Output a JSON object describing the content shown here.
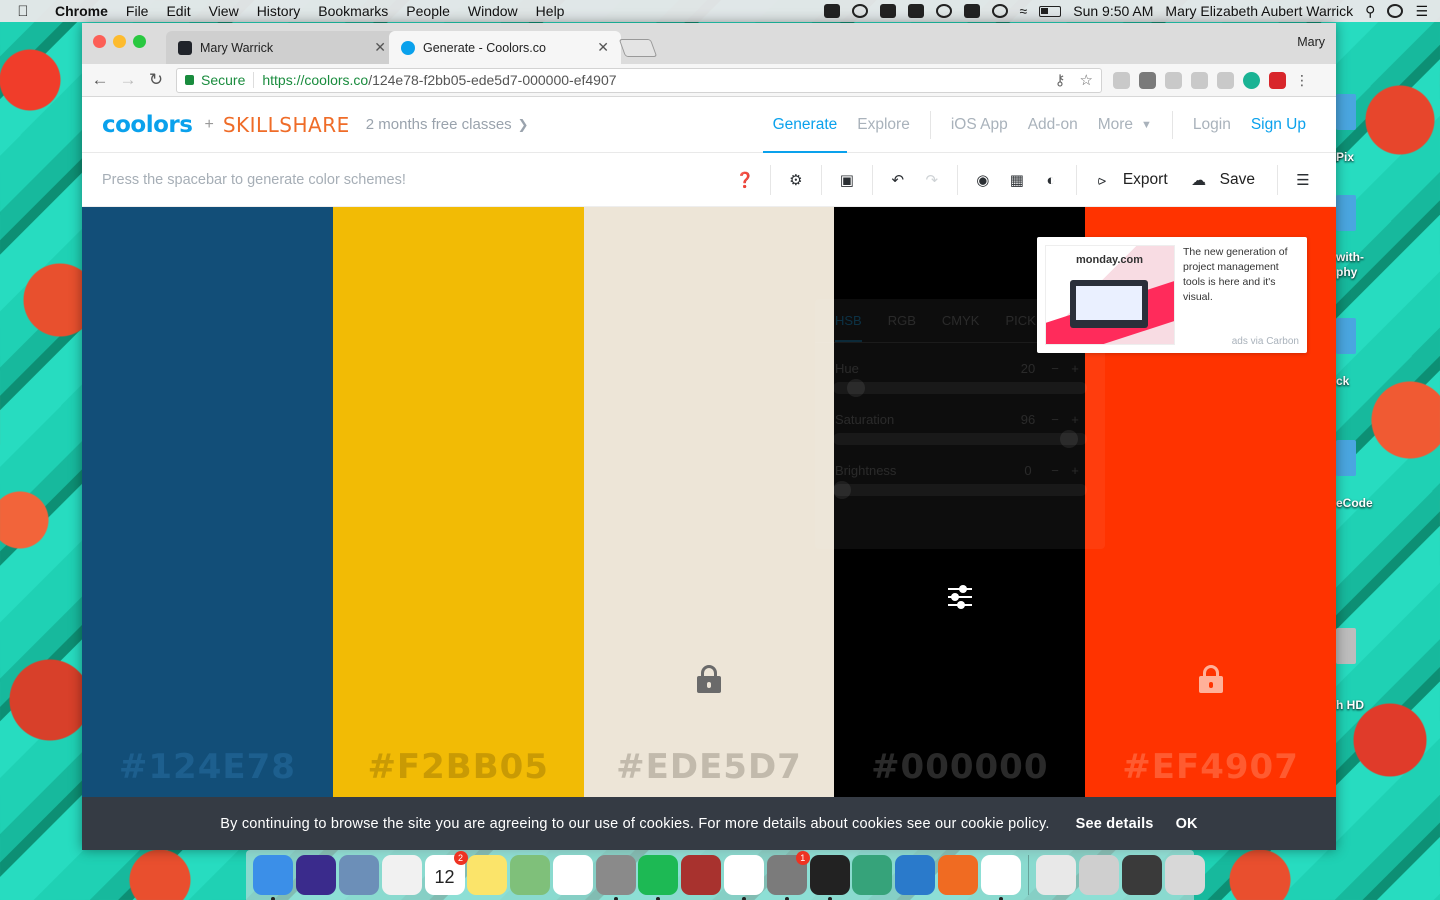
{
  "menubar": {
    "apple": "",
    "items": [
      "Chrome",
      "File",
      "Edit",
      "View",
      "History",
      "Bookmarks",
      "People",
      "Window",
      "Help"
    ],
    "clock": "Sun 9:50 AM",
    "user": "Mary Elizabeth Aubert Warrick"
  },
  "browser": {
    "tabs": [
      {
        "title": "Mary Warrick",
        "favicon_color": "#20232a"
      },
      {
        "title": "Generate - Coolors.co",
        "favicon_color": "#0aa1ec"
      }
    ],
    "profile": "Mary",
    "secure_label": "Secure",
    "url_scheme_host": "https://coolors.co",
    "url_path": "/124e78-f2bb05-ede5d7-000000-ef4907"
  },
  "site": {
    "logo": "coolors",
    "plus": "+",
    "partner": "SKILLSHARE",
    "promo": "2 months free classes",
    "nav": {
      "generate": "Generate",
      "explore": "Explore",
      "ios": "iOS App",
      "addon": "Add-on",
      "more": "More",
      "login": "Login",
      "signup": "Sign Up"
    },
    "hint": "Press the spacebar to generate color schemes!",
    "export_label": "Export",
    "save_label": "Save"
  },
  "palette": {
    "colors": [
      {
        "hex": "#124E78",
        "bg": "#124e78",
        "fg": "#1d5f8e",
        "locked": false
      },
      {
        "hex": "#F2BB05",
        "bg": "#f2bb05",
        "fg": "#c99a04",
        "locked": false
      },
      {
        "hex": "#EDE5D7",
        "bg": "#ede5d7",
        "fg": "#c2baac",
        "locked": true,
        "lock_color": "#6a6a6a"
      },
      {
        "hex": "#000000",
        "bg": "#000000",
        "fg": "#2a2a2a",
        "locked": false
      },
      {
        "hex": "#EF4907",
        "bg": "#ff3300",
        "fg": "#ff5b30",
        "locked": true,
        "lock_color": "#ffb199"
      }
    ]
  },
  "adjust": {
    "tabs": [
      "HSB",
      "RGB",
      "CMYK",
      "PICK"
    ],
    "hue_label": "Hue",
    "hue_value": "20",
    "saturation_label": "Saturation",
    "saturation_value": "96",
    "brightness_label": "Brightness",
    "brightness_value": "0",
    "hue_level": 0.06,
    "saturation_level": 0.96,
    "brightness_level": 0.0
  },
  "ad": {
    "brand": "monday.com",
    "text": "The new generation of project management tools is here and it's visual.",
    "via": "ads via Carbon"
  },
  "cookie": {
    "message": "By continuing to browse the site you are agreeing to our use of cookies. For more details about cookies see our cookie policy.",
    "details": "See details",
    "ok": "OK"
  },
  "desktop": {
    "labels": [
      "Pix",
      "with-\nphy",
      "ck",
      "eCode",
      "h HD"
    ]
  },
  "dock": {
    "apps": [
      {
        "name": "finder",
        "color": "#3b8fe8",
        "dot": true
      },
      {
        "name": "siri",
        "color": "#3a2b8c",
        "dot": false
      },
      {
        "name": "preview",
        "color": "#6c8fb8",
        "dot": false
      },
      {
        "name": "textedit",
        "color": "#f1f1f1",
        "dot": false
      },
      {
        "name": "calendar",
        "color": "#ffffff",
        "dot": false,
        "badge": "2",
        "label": "12"
      },
      {
        "name": "notes",
        "color": "#fbe46a",
        "dot": false
      },
      {
        "name": "maps",
        "color": "#7fc07a",
        "dot": false
      },
      {
        "name": "photos",
        "color": "#ffffff",
        "dot": false
      },
      {
        "name": "calculator",
        "color": "#8a8a8a",
        "dot": true
      },
      {
        "name": "spotify",
        "color": "#1db954",
        "dot": true
      },
      {
        "name": "dictionary",
        "color": "#a8322e",
        "dot": false
      },
      {
        "name": "chrome",
        "color": "#ffffff",
        "dot": true
      },
      {
        "name": "system-preferences",
        "color": "#7b7b7b",
        "dot": true,
        "badge": "1"
      },
      {
        "name": "terminal",
        "color": "#222222",
        "dot": true
      },
      {
        "name": "atom",
        "color": "#36a37a",
        "dot": false
      },
      {
        "name": "vscode",
        "color": "#2a7acb",
        "dot": false
      },
      {
        "name": "pages",
        "color": "#f06b22",
        "dot": false
      },
      {
        "name": "sublime",
        "color": "#ffffff",
        "dot": true
      },
      {
        "name": "archive",
        "color": "#e8e8e8",
        "dot": false
      },
      {
        "name": "downloads",
        "color": "#cfcfcf",
        "dot": false
      },
      {
        "name": "desktop-stack",
        "color": "#3a3a3a",
        "dot": false
      },
      {
        "name": "trash",
        "color": "#d8d8d8",
        "dot": false
      }
    ]
  }
}
